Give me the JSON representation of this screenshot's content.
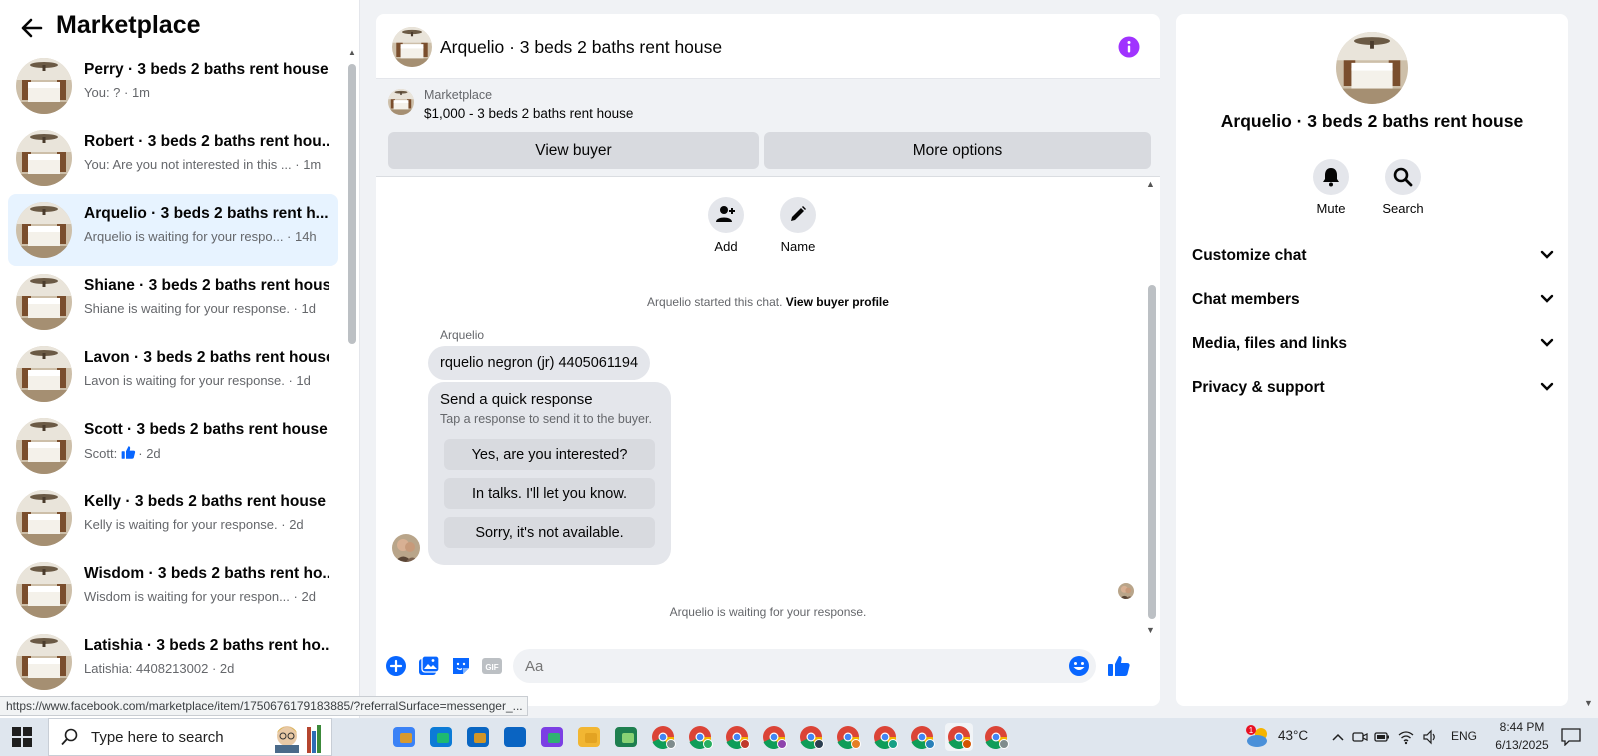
{
  "sidebar": {
    "title": "Marketplace",
    "conversations": [
      {
        "title": "Perry · 3 beds 2 baths rent house",
        "subtitle": "You: ? · 1m",
        "active": false
      },
      {
        "title": "Robert · 3 beds 2 baths rent hou...",
        "subtitle": "You: Are you not interested in this ... · 1m",
        "active": false
      },
      {
        "title": "Arquelio · 3 beds 2 baths rent h...",
        "subtitle": "Arquelio is waiting for your respo... · 14h",
        "active": true
      },
      {
        "title": "Shiane · 3 beds 2 baths rent house",
        "subtitle": "Shiane is waiting for your response. · 1d",
        "active": false
      },
      {
        "title": "Lavon · 3 beds 2 baths rent house",
        "subtitle": "Lavon is waiting for your response. · 1d",
        "active": false
      },
      {
        "title": "Scott · 3 beds 2 baths rent house",
        "subtitle_prefix": "Scott:",
        "subtitle_suffix": "· 2d",
        "active": false
      },
      {
        "title": "Kelly · 3 beds 2 baths rent house",
        "subtitle": "Kelly is waiting for your response. · 2d",
        "active": false
      },
      {
        "title": "Wisdom · 3 beds 2 baths rent ho...",
        "subtitle": "Wisdom is waiting for your respon... · 2d",
        "active": false
      },
      {
        "title": "Latishia · 3 beds 2 baths rent ho...",
        "subtitle": "Latishia: 4408213002 · 2d",
        "active": false
      }
    ]
  },
  "chat": {
    "title": "Arquelio · 3 beds 2 baths rent house",
    "listing": {
      "source": "Marketplace",
      "price_title": "$1,000 - 3 beds 2 baths rent house",
      "view_buyer_label": "View buyer",
      "more_options_label": "More options"
    },
    "actions": {
      "add_label": "Add",
      "name_label": "Name"
    },
    "started_text": "Arquelio started this chat.",
    "started_link": "View buyer profile",
    "sender_name": "Arquelio",
    "message": "rquelio negron (jr) 4405061194",
    "quick_response": {
      "title": "Send a quick response",
      "subtitle": "Tap a response to send it to the buyer.",
      "options": [
        "Yes, are you interested?",
        "In talks. I'll let you know.",
        "Sorry, it's not available."
      ]
    },
    "waiting_text": "Arquelio is waiting for your response.",
    "composer": {
      "placeholder": "Aa"
    }
  },
  "panel": {
    "title": "Arquelio · 3 beds 2 baths rent house",
    "actions": {
      "mute_label": "Mute",
      "search_label": "Search"
    },
    "sections": [
      "Customize chat",
      "Chat members",
      "Media, files and links",
      "Privacy & support"
    ]
  },
  "status_url": "https://www.facebook.com/marketplace/item/1750676179183885/?referralSurface=messenger_...",
  "taskbar": {
    "search_placeholder": "Type here to search",
    "temperature": "43°C",
    "language": "ENG",
    "time": "8:44 PM",
    "date": "6/13/2025",
    "weather_badge": "1",
    "apps": [
      "copilot-icon",
      "edge-icon",
      "store-icon",
      "outlook-icon",
      "m365-icon",
      "file-explorer-icon",
      "app-icon",
      "chrome-icon"
    ]
  },
  "colors": {
    "accent": "#0866ff",
    "active_row": "#e7f3ff",
    "info_purple": "#a033ff"
  }
}
